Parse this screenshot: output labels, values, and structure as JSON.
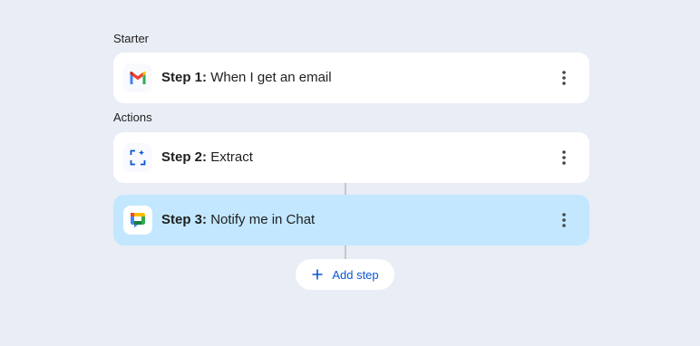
{
  "sections": {
    "starter_label": "Starter",
    "actions_label": "Actions"
  },
  "steps": [
    {
      "number": "Step 1:",
      "text": "When I get an email",
      "icon": "gmail-icon",
      "active": false
    },
    {
      "number": "Step 2:",
      "text": "Extract",
      "icon": "extract-icon",
      "active": false
    },
    {
      "number": "Step 3:",
      "text": "Notify me in Chat",
      "icon": "google-chat-icon",
      "active": true
    }
  ],
  "add_step": {
    "label": "Add step",
    "icon": "plus-icon"
  },
  "colors": {
    "background": "#e9edf5",
    "card": "#ffffff",
    "active_card": "#c2e7ff",
    "accent": "#0b57d0",
    "connector": "#c4c7c5"
  }
}
